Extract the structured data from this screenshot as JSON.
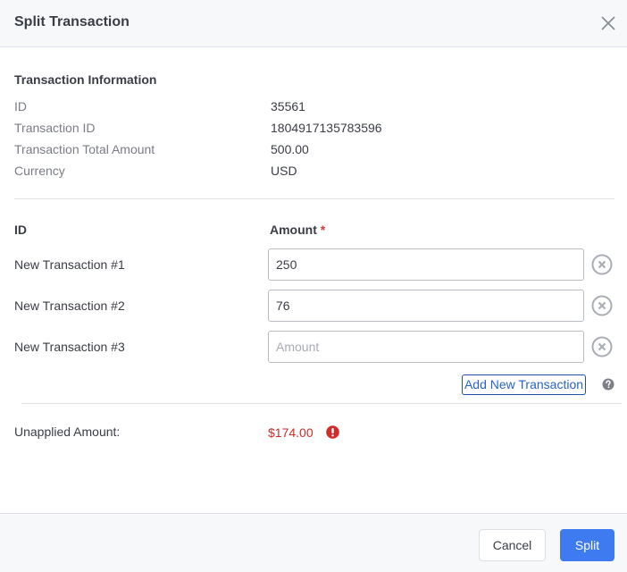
{
  "dialog": {
    "title": "Split Transaction",
    "close_icon": "close-icon"
  },
  "transaction_info": {
    "title": "Transaction Information",
    "rows": [
      {
        "label": "ID",
        "value": "35561"
      },
      {
        "label": "Transaction ID",
        "value": "1804917135783596"
      },
      {
        "label": "Transaction Total Amount",
        "value": "500.00"
      },
      {
        "label": "Currency",
        "value": "USD"
      }
    ]
  },
  "split_table": {
    "id_header": "ID",
    "amount_header": "Amount",
    "required_marker": "*",
    "amount_placeholder": "Amount",
    "rows": [
      {
        "label": "New Transaction #1",
        "value": "250"
      },
      {
        "label": "New Transaction #2",
        "value": "76"
      },
      {
        "label": "New Transaction #3",
        "value": ""
      }
    ],
    "remove_icon": "circle-x-icon",
    "add_button_label": "Add New Transaction",
    "help_icon": "question-circle-icon"
  },
  "summary": {
    "unapplied_label": "Unapplied Amount:",
    "unapplied_value": "$174.00",
    "warning_icon": "exclamation-circle-icon",
    "warning_color": "#d12b2b"
  },
  "footer": {
    "cancel_label": "Cancel",
    "split_label": "Split",
    "primary_color": "#3f7bf0"
  }
}
